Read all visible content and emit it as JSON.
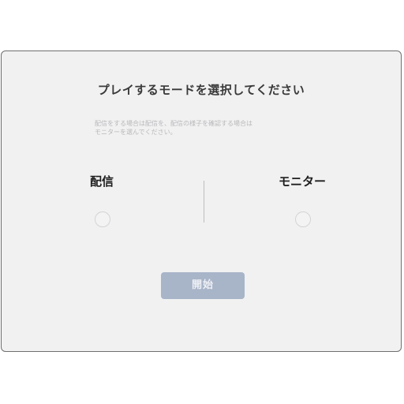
{
  "dialog": {
    "title": "プレイするモードを選択してください",
    "description": "配信をする場合は配信を、配信の様子を確認する場合は\nモニターを選んでください。",
    "options": [
      {
        "label": "配信",
        "selected": false
      },
      {
        "label": "モニター",
        "selected": false
      }
    ],
    "start_button_label": "開始",
    "start_button_enabled": false
  },
  "colors": {
    "panel_background": "#f1f1f2",
    "panel_border": "#6f6f6f",
    "button_disabled": "#a8b4c8",
    "title_text": "#3a3a3a",
    "description_text": "#b9b9bb"
  }
}
